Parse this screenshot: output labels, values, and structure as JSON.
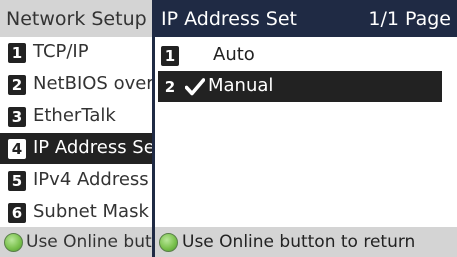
{
  "background_menu": {
    "title": "Network Setup",
    "items": [
      {
        "number": "1",
        "label": "TCP/IP"
      },
      {
        "number": "2",
        "label": "NetBIOS over TCP"
      },
      {
        "number": "3",
        "label": "EtherTalk"
      },
      {
        "number": "4",
        "label": "IP Address Set"
      },
      {
        "number": "5",
        "label": "IPv4 Address"
      },
      {
        "number": "6",
        "label": "Subnet Mask"
      }
    ],
    "footer": "Use Online button to return"
  },
  "dialog": {
    "title": "IP Address Set",
    "page": "1/1 Page",
    "options": [
      {
        "number": "1",
        "label": "Auto"
      },
      {
        "number": "2",
        "label": "Manual"
      }
    ],
    "footer": "Use Online button to return"
  },
  "colors": {
    "header_dark": "#1f2a44",
    "selection": "#222222",
    "header_gray": "#d4d4d4",
    "online_led": "#7cc24f"
  },
  "icons": {
    "checkmark": "checkmark-icon",
    "online_indicator": "online-led-icon"
  }
}
